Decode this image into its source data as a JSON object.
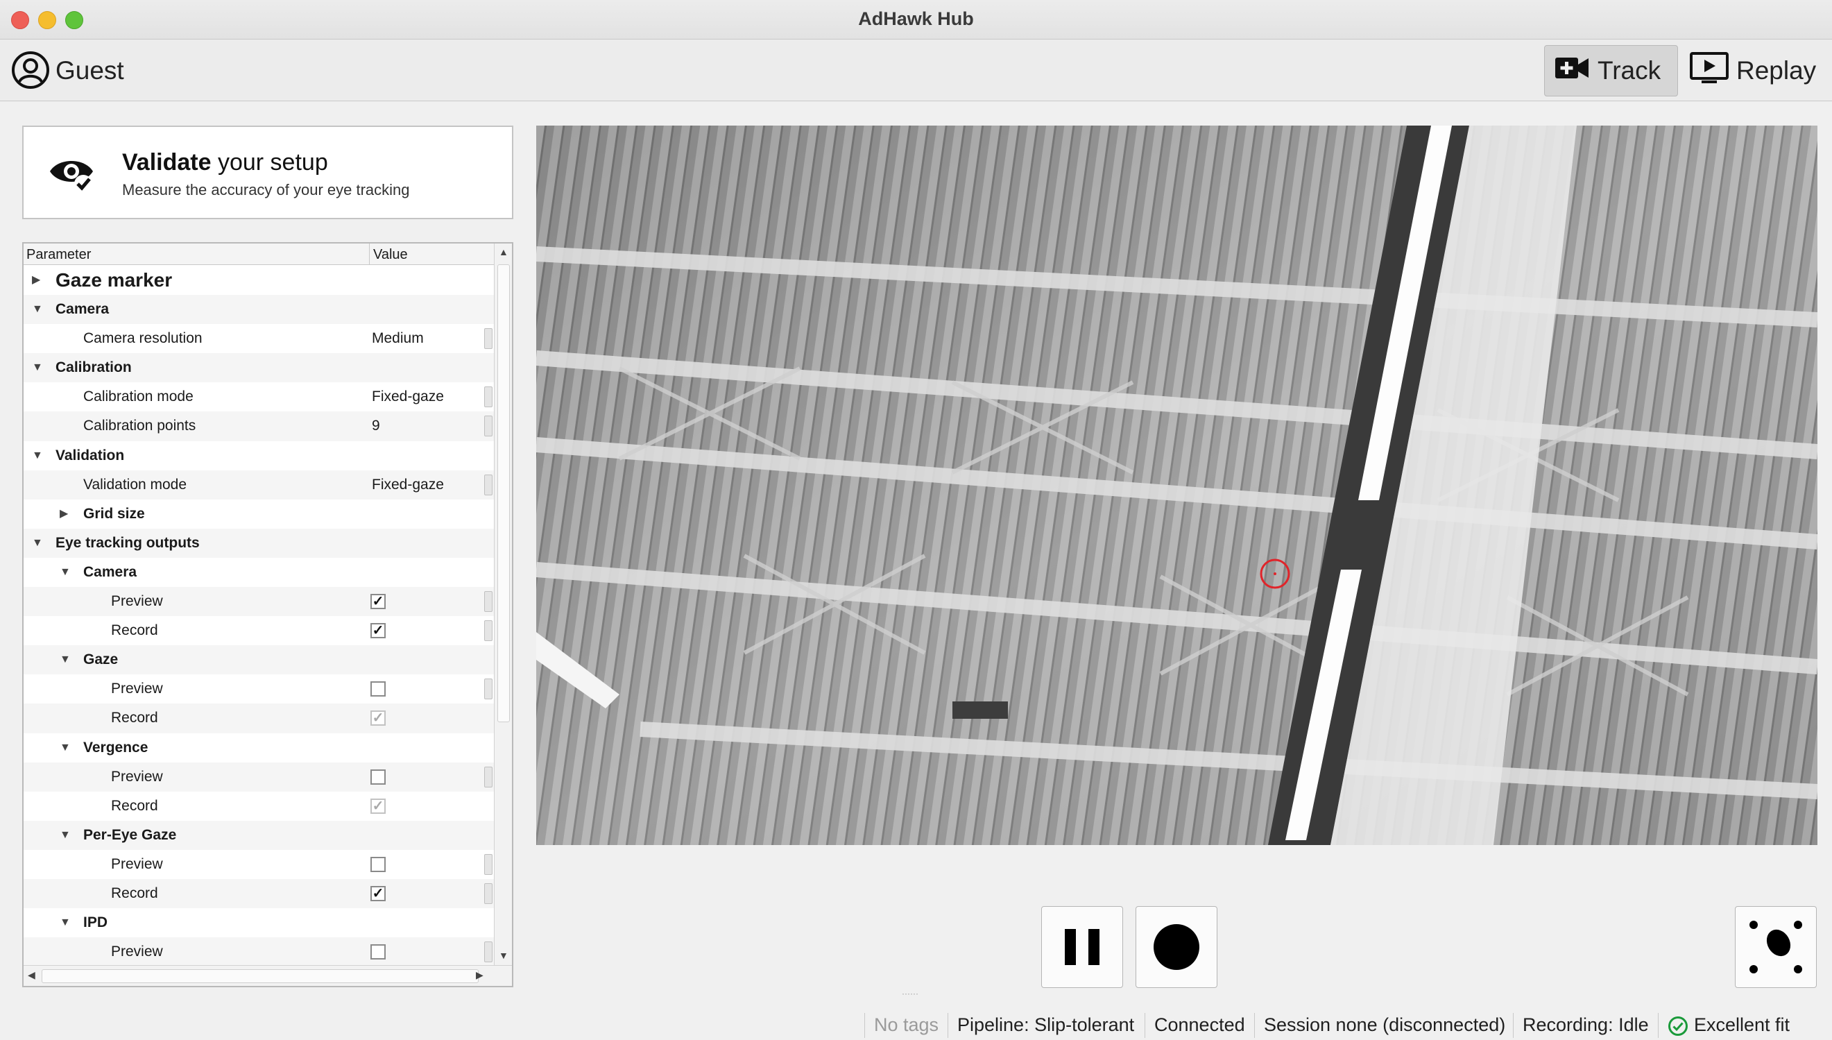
{
  "window": {
    "title": "AdHawk Hub"
  },
  "toolbar": {
    "user_name": "Guest",
    "track_label": "Track",
    "replay_label": "Replay"
  },
  "setup_card": {
    "title_bold": "Validate",
    "title_rest": " your setup",
    "subtitle": "Measure the accuracy of your eye tracking"
  },
  "tree": {
    "col_parameter": "Parameter",
    "col_value": "Value",
    "rows": [
      {
        "label": "Gaze marker",
        "level": 0,
        "expander": "collapsed",
        "style": "big"
      },
      {
        "label": "Camera",
        "level": 0,
        "expander": "expanded",
        "style": "group"
      },
      {
        "label": "Camera resolution",
        "level": 1,
        "value": "Medium",
        "spin": true
      },
      {
        "label": "Calibration",
        "level": 0,
        "expander": "expanded",
        "style": "group"
      },
      {
        "label": "Calibration mode",
        "level": 1,
        "value": "Fixed-gaze",
        "spin": true
      },
      {
        "label": "Calibration points",
        "level": 1,
        "value": "9",
        "spin": true
      },
      {
        "label": "Validation",
        "level": 0,
        "expander": "expanded",
        "style": "group"
      },
      {
        "label": "Validation mode",
        "level": 1,
        "value": "Fixed-gaze",
        "spin": true
      },
      {
        "label": "Grid size",
        "level": 1,
        "expander": "collapsed",
        "style": "group"
      },
      {
        "label": "Eye tracking outputs",
        "level": 0,
        "expander": "expanded",
        "style": "group"
      },
      {
        "label": "Camera",
        "level": 1,
        "expander": "expanded",
        "style": "group"
      },
      {
        "label": "Preview",
        "level": 2,
        "check": "checked",
        "spin": true
      },
      {
        "label": "Record",
        "level": 2,
        "check": "checked",
        "spin": true
      },
      {
        "label": "Gaze",
        "level": 1,
        "expander": "expanded",
        "style": "group"
      },
      {
        "label": "Preview",
        "level": 2,
        "check": "unchecked",
        "spin": true
      },
      {
        "label": "Record",
        "level": 2,
        "check": "checked-disabled"
      },
      {
        "label": "Vergence",
        "level": 1,
        "expander": "expanded",
        "style": "group"
      },
      {
        "label": "Preview",
        "level": 2,
        "check": "unchecked",
        "spin": true
      },
      {
        "label": "Record",
        "level": 2,
        "check": "checked-disabled"
      },
      {
        "label": "Per-Eye Gaze",
        "level": 1,
        "expander": "expanded",
        "style": "group"
      },
      {
        "label": "Preview",
        "level": 2,
        "check": "unchecked",
        "spin": true
      },
      {
        "label": "Record",
        "level": 2,
        "check": "checked",
        "spin": true
      },
      {
        "label": "IPD",
        "level": 1,
        "expander": "expanded",
        "style": "group"
      },
      {
        "label": "Preview",
        "level": 2,
        "check": "unchecked",
        "spin": true
      }
    ]
  },
  "status_bar": {
    "tags": "No tags",
    "pipeline": "Pipeline: Slip-tolerant",
    "connection": "Connected",
    "session": "Session none (disconnected)",
    "recording": "Recording: Idle",
    "fit": "Excellent fit"
  },
  "icons": {
    "user": "user-circle-icon",
    "track": "video-plus-icon",
    "replay": "play-screen-icon",
    "setup": "eye-check-icon",
    "pause": "pause-icon",
    "record": "record-icon",
    "calibrate": "calibration-dots-icon",
    "fit": "check-circle-icon"
  },
  "colors": {
    "fit_ok": "#1a9a3a",
    "gaze_marker": "#e0242a",
    "tags_muted": "#9a9a9a"
  }
}
